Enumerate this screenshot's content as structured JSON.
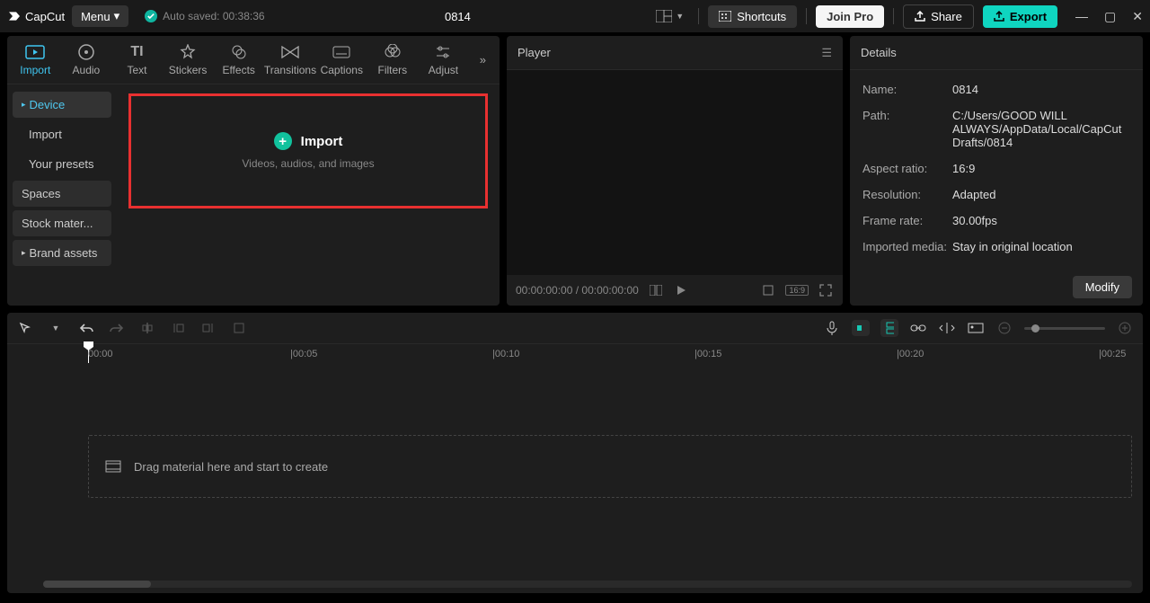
{
  "app": {
    "name": "CapCut",
    "menu": "Menu",
    "autosaved": "Auto saved: 00:38:36",
    "title": "0814"
  },
  "titlebar": {
    "shortcuts": "Shortcuts",
    "joinpro": "Join Pro",
    "share": "Share",
    "export": "Export"
  },
  "tooltabs": [
    "Import",
    "Audio",
    "Text",
    "Stickers",
    "Effects",
    "Transitions",
    "Captions",
    "Filters",
    "Adjust"
  ],
  "tree": {
    "device": "Device",
    "import": "Import",
    "presets": "Your presets",
    "spaces": "Spaces",
    "stock": "Stock mater...",
    "brand": "Brand assets"
  },
  "importZone": {
    "title": "Import",
    "sub": "Videos, audios, and images"
  },
  "player": {
    "title": "Player",
    "time": "00:00:00:00 / 00:00:00:00",
    "ratioBadge": "16:9"
  },
  "details": {
    "title": "Details",
    "rows": {
      "name_l": "Name:",
      "name_v": "0814",
      "path_l": "Path:",
      "path_v": "C:/Users/GOOD WILL ALWAYS/AppData/Local/CapCut Drafts/0814",
      "ar_l": "Aspect ratio:",
      "ar_v": "16:9",
      "res_l": "Resolution:",
      "res_v": "Adapted",
      "fr_l": "Frame rate:",
      "fr_v": "30.00fps",
      "im_l": "Imported media:",
      "im_v": "Stay in original location"
    },
    "modify": "Modify"
  },
  "timeline": {
    "marks": [
      "00:00",
      "|00:05",
      "|00:10",
      "|00:15",
      "|00:20",
      "|00:25"
    ],
    "dropHint": "Drag material here and start to create"
  }
}
